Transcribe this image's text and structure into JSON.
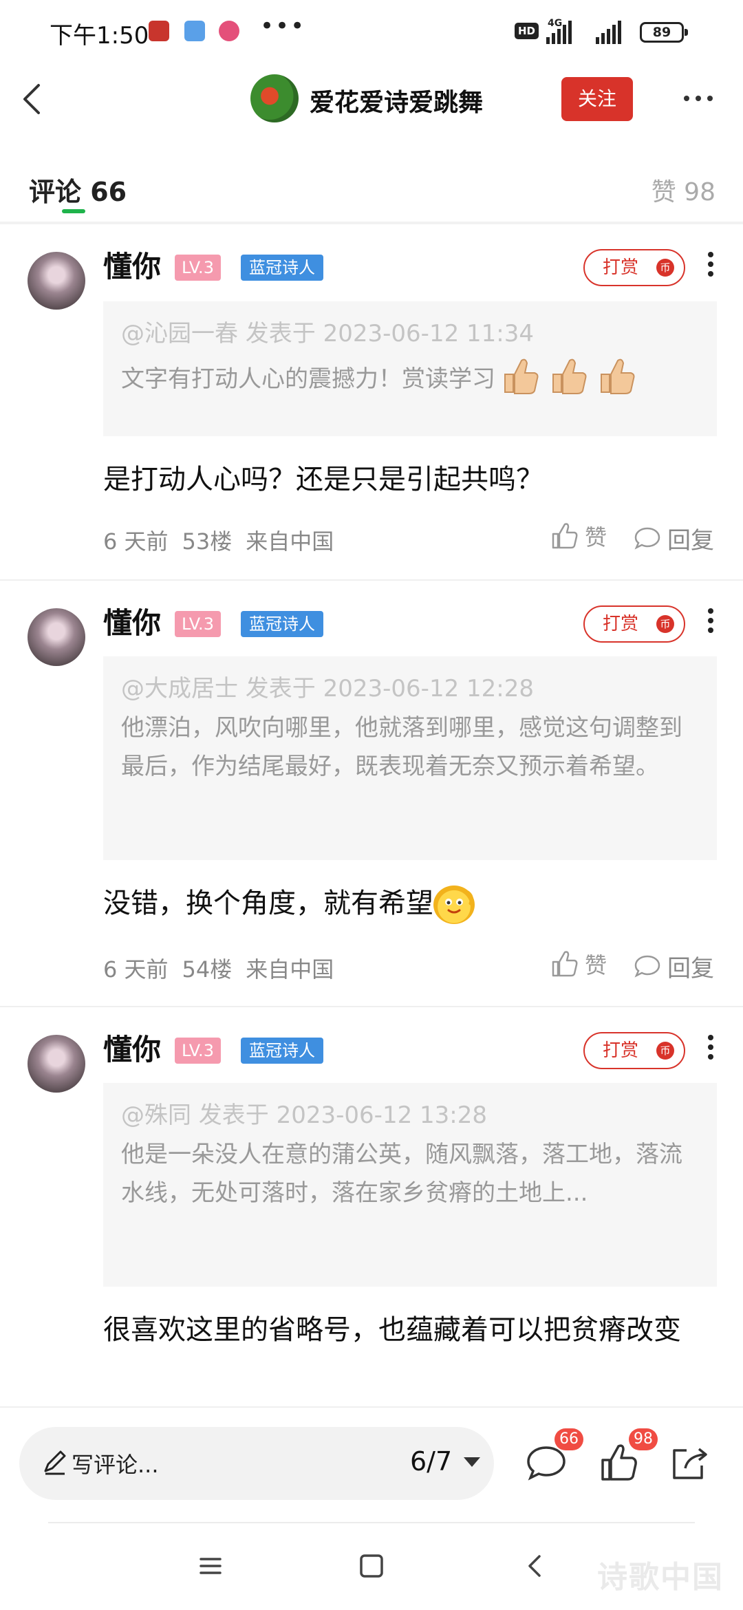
{
  "status_bar": {
    "time": "下午1:50",
    "hd": "HD",
    "network": "4G",
    "battery": "89",
    "dots": "•••"
  },
  "header": {
    "author_name": "爱花爱诗爱跳舞",
    "follow_label": "关注",
    "more_icon": "more-horizontal-icon"
  },
  "tabs": {
    "comments_label": "评论 66",
    "likes_label": "赞 98"
  },
  "comments": [
    {
      "user": "懂你",
      "level": "LV.3",
      "title": "蓝冠诗人",
      "tip_label": "打赏",
      "tip_coin": "币",
      "quote_meta": "@沁园一春 发表于 2023-06-12 11:34",
      "quote_text": "文字有打动人心的震撼力！赏读学习",
      "reply": "是打动人心吗？还是只是引起共鸣？",
      "time": "6 天前",
      "floor": "53楼",
      "location": "来自中国",
      "like_label": "赞",
      "reply_label": "回复"
    },
    {
      "user": "懂你",
      "level": "LV.3",
      "title": "蓝冠诗人",
      "tip_label": "打赏",
      "tip_coin": "币",
      "quote_meta": "@大成居士 发表于 2023-06-12 12:28",
      "quote_text": "他漂泊，风吹向哪里，他就落到哪里，感觉这句调整到最后，作为结尾最好，既表现着无奈又预示着希望。",
      "reply": "没错，换个角度，就有希望",
      "time": "6 天前",
      "floor": "54楼",
      "location": "来自中国",
      "like_label": "赞",
      "reply_label": "回复"
    },
    {
      "user": "懂你",
      "level": "LV.3",
      "title": "蓝冠诗人",
      "tip_label": "打赏",
      "tip_coin": "币",
      "quote_meta": "@殊同 发表于 2023-06-12 13:28",
      "quote_text": "他是一朵没人在意的蒲公英，随风飘落，落工地，落流水线，无处可落时，落在家乡贫瘠的土地上...",
      "reply": "很喜欢这里的省略号，也蕴藏着可以把贫瘠改变"
    }
  ],
  "bottom_bar": {
    "write_placeholder": "写评论...",
    "page_indicator": "6/7",
    "comment_count": "66",
    "like_count": "98"
  },
  "watermark": "诗歌中国",
  "colors": {
    "accent_red": "#d8332a",
    "tab_green": "#1fb34b",
    "level_pink": "#f59aae",
    "title_blue": "#3f8fe0",
    "badge_red": "#f04c43"
  }
}
